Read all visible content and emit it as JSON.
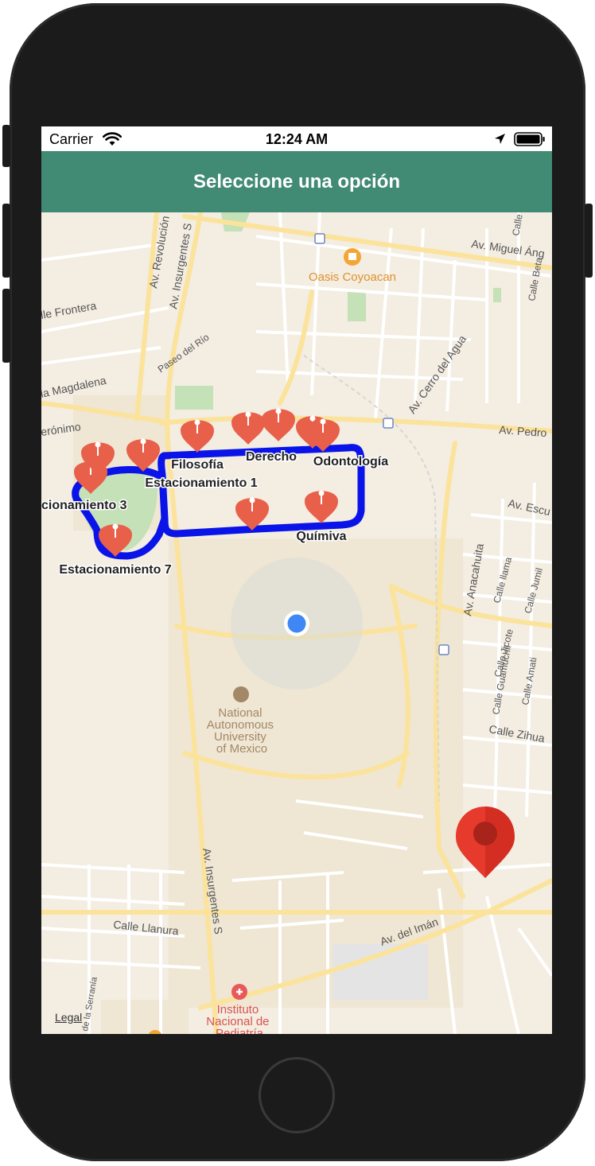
{
  "status_bar": {
    "carrier": "Carrier",
    "time": "12:24 AM"
  },
  "header": {
    "title": "Seleccione una opción"
  },
  "map": {
    "streets": {
      "revolucion": "Av. Revolución",
      "insurgentes_top": "Av. Insurgentes S",
      "miguel_angel": "Av. Miguel Áng",
      "calle": "Calle",
      "calle_beta": "Calle Beta",
      "frontera": "lle Frontera",
      "paseo_rio": "Paseo del Río",
      "magdalena": "la Magdalena",
      "cerro_agua": "Av. Cerro del Agua",
      "geronimo": "erónimo",
      "pedro": "Av. Pedro",
      "escu": "Av. Escu",
      "anacahuita": "Av. Anacahuita",
      "llama": "Calle llama",
      "jumil": "Calle Jumil",
      "jicote": "Calle Jicote",
      "guamuchil": "Calle Guamuchil",
      "amati": "Calle Amati",
      "zihua": "Calle Zihua",
      "insurgentes_bottom": "Av. Insurgentes S",
      "llanura": "Calle Llanura",
      "iman": "Av. del Imán",
      "serrania": "de la Serranía"
    },
    "pois": {
      "oasis": "Oasis Coyoacan",
      "unam": [
        "National",
        "Autonomous",
        "University",
        "of Mexico"
      ],
      "instituto": [
        "Instituto",
        "Nacional de",
        "Pediatría"
      ]
    },
    "markers": {
      "filosofia": "Filosofía",
      "derecho": "Derecho",
      "odontologia": "Odontología",
      "estacionamiento1": "Estacionamiento 1",
      "estacionamiento3": "cionamiento 3",
      "quimica": "Químiva",
      "estacionamiento7": "Estacionamiento 7"
    },
    "legal": "Legal"
  },
  "colors": {
    "nav_bar": "#418a74",
    "route": "#0a14e8",
    "pin": "#e8604a",
    "destination_pin": "#e53a2c",
    "user_location": "#3f87f5"
  }
}
